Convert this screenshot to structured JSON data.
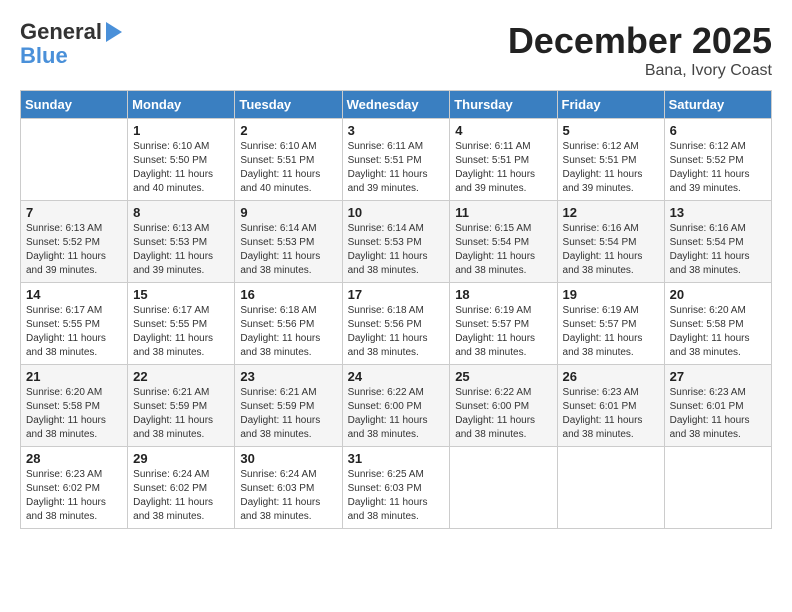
{
  "logo": {
    "line1": "General",
    "line2": "Blue"
  },
  "title": "December 2025",
  "subtitle": "Bana, Ivory Coast",
  "days": [
    "Sunday",
    "Monday",
    "Tuesday",
    "Wednesday",
    "Thursday",
    "Friday",
    "Saturday"
  ],
  "weeks": [
    [
      {
        "day": "",
        "info": ""
      },
      {
        "day": "1",
        "info": "Sunrise: 6:10 AM\nSunset: 5:50 PM\nDaylight: 11 hours\nand 40 minutes."
      },
      {
        "day": "2",
        "info": "Sunrise: 6:10 AM\nSunset: 5:51 PM\nDaylight: 11 hours\nand 40 minutes."
      },
      {
        "day": "3",
        "info": "Sunrise: 6:11 AM\nSunset: 5:51 PM\nDaylight: 11 hours\nand 39 minutes."
      },
      {
        "day": "4",
        "info": "Sunrise: 6:11 AM\nSunset: 5:51 PM\nDaylight: 11 hours\nand 39 minutes."
      },
      {
        "day": "5",
        "info": "Sunrise: 6:12 AM\nSunset: 5:51 PM\nDaylight: 11 hours\nand 39 minutes."
      },
      {
        "day": "6",
        "info": "Sunrise: 6:12 AM\nSunset: 5:52 PM\nDaylight: 11 hours\nand 39 minutes."
      }
    ],
    [
      {
        "day": "7",
        "info": "Sunrise: 6:13 AM\nSunset: 5:52 PM\nDaylight: 11 hours\nand 39 minutes."
      },
      {
        "day": "8",
        "info": "Sunrise: 6:13 AM\nSunset: 5:53 PM\nDaylight: 11 hours\nand 39 minutes."
      },
      {
        "day": "9",
        "info": "Sunrise: 6:14 AM\nSunset: 5:53 PM\nDaylight: 11 hours\nand 38 minutes."
      },
      {
        "day": "10",
        "info": "Sunrise: 6:14 AM\nSunset: 5:53 PM\nDaylight: 11 hours\nand 38 minutes."
      },
      {
        "day": "11",
        "info": "Sunrise: 6:15 AM\nSunset: 5:54 PM\nDaylight: 11 hours\nand 38 minutes."
      },
      {
        "day": "12",
        "info": "Sunrise: 6:16 AM\nSunset: 5:54 PM\nDaylight: 11 hours\nand 38 minutes."
      },
      {
        "day": "13",
        "info": "Sunrise: 6:16 AM\nSunset: 5:54 PM\nDaylight: 11 hours\nand 38 minutes."
      }
    ],
    [
      {
        "day": "14",
        "info": "Sunrise: 6:17 AM\nSunset: 5:55 PM\nDaylight: 11 hours\nand 38 minutes."
      },
      {
        "day": "15",
        "info": "Sunrise: 6:17 AM\nSunset: 5:55 PM\nDaylight: 11 hours\nand 38 minutes."
      },
      {
        "day": "16",
        "info": "Sunrise: 6:18 AM\nSunset: 5:56 PM\nDaylight: 11 hours\nand 38 minutes."
      },
      {
        "day": "17",
        "info": "Sunrise: 6:18 AM\nSunset: 5:56 PM\nDaylight: 11 hours\nand 38 minutes."
      },
      {
        "day": "18",
        "info": "Sunrise: 6:19 AM\nSunset: 5:57 PM\nDaylight: 11 hours\nand 38 minutes."
      },
      {
        "day": "19",
        "info": "Sunrise: 6:19 AM\nSunset: 5:57 PM\nDaylight: 11 hours\nand 38 minutes."
      },
      {
        "day": "20",
        "info": "Sunrise: 6:20 AM\nSunset: 5:58 PM\nDaylight: 11 hours\nand 38 minutes."
      }
    ],
    [
      {
        "day": "21",
        "info": "Sunrise: 6:20 AM\nSunset: 5:58 PM\nDaylight: 11 hours\nand 38 minutes."
      },
      {
        "day": "22",
        "info": "Sunrise: 6:21 AM\nSunset: 5:59 PM\nDaylight: 11 hours\nand 38 minutes."
      },
      {
        "day": "23",
        "info": "Sunrise: 6:21 AM\nSunset: 5:59 PM\nDaylight: 11 hours\nand 38 minutes."
      },
      {
        "day": "24",
        "info": "Sunrise: 6:22 AM\nSunset: 6:00 PM\nDaylight: 11 hours\nand 38 minutes."
      },
      {
        "day": "25",
        "info": "Sunrise: 6:22 AM\nSunset: 6:00 PM\nDaylight: 11 hours\nand 38 minutes."
      },
      {
        "day": "26",
        "info": "Sunrise: 6:23 AM\nSunset: 6:01 PM\nDaylight: 11 hours\nand 38 minutes."
      },
      {
        "day": "27",
        "info": "Sunrise: 6:23 AM\nSunset: 6:01 PM\nDaylight: 11 hours\nand 38 minutes."
      }
    ],
    [
      {
        "day": "28",
        "info": "Sunrise: 6:23 AM\nSunset: 6:02 PM\nDaylight: 11 hours\nand 38 minutes."
      },
      {
        "day": "29",
        "info": "Sunrise: 6:24 AM\nSunset: 6:02 PM\nDaylight: 11 hours\nand 38 minutes."
      },
      {
        "day": "30",
        "info": "Sunrise: 6:24 AM\nSunset: 6:03 PM\nDaylight: 11 hours\nand 38 minutes."
      },
      {
        "day": "31",
        "info": "Sunrise: 6:25 AM\nSunset: 6:03 PM\nDaylight: 11 hours\nand 38 minutes."
      },
      {
        "day": "",
        "info": ""
      },
      {
        "day": "",
        "info": ""
      },
      {
        "day": "",
        "info": ""
      }
    ]
  ]
}
